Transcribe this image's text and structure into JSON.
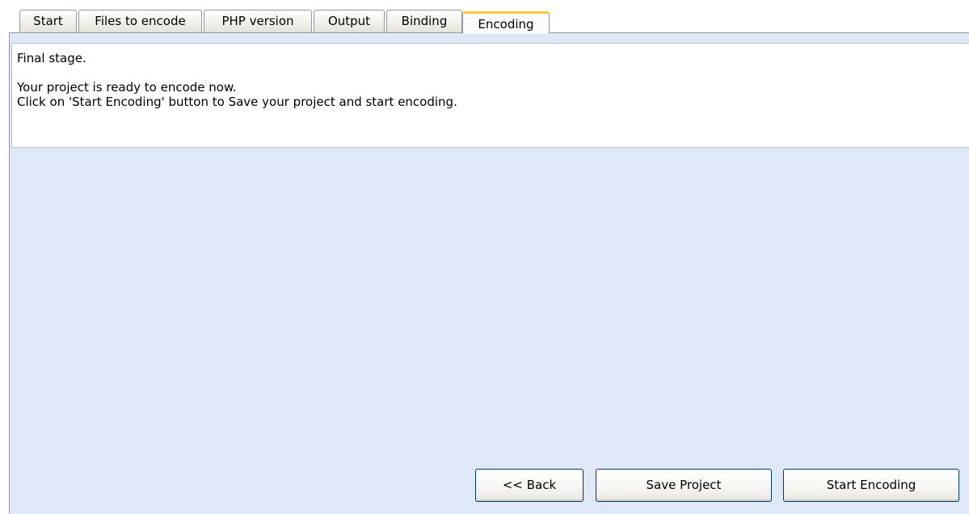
{
  "tabs": [
    {
      "label": "Start",
      "active": false
    },
    {
      "label": "Files to encode",
      "active": false
    },
    {
      "label": "PHP version",
      "active": false
    },
    {
      "label": "Output",
      "active": false
    },
    {
      "label": "Binding",
      "active": false
    },
    {
      "label": "Encoding",
      "active": true
    }
  ],
  "info": {
    "line1": "Final stage.",
    "line2": "Your project is ready to encode now.",
    "line3": "Click on 'Start Encoding' button to Save your project and start encoding."
  },
  "buttons": {
    "back": "<< Back",
    "save": "Save Project",
    "start": "Start Encoding"
  },
  "colors": {
    "panel_background": "#dfe8f6",
    "active_tab_highlight": "#ffc83c",
    "button_border": "#003c74"
  }
}
